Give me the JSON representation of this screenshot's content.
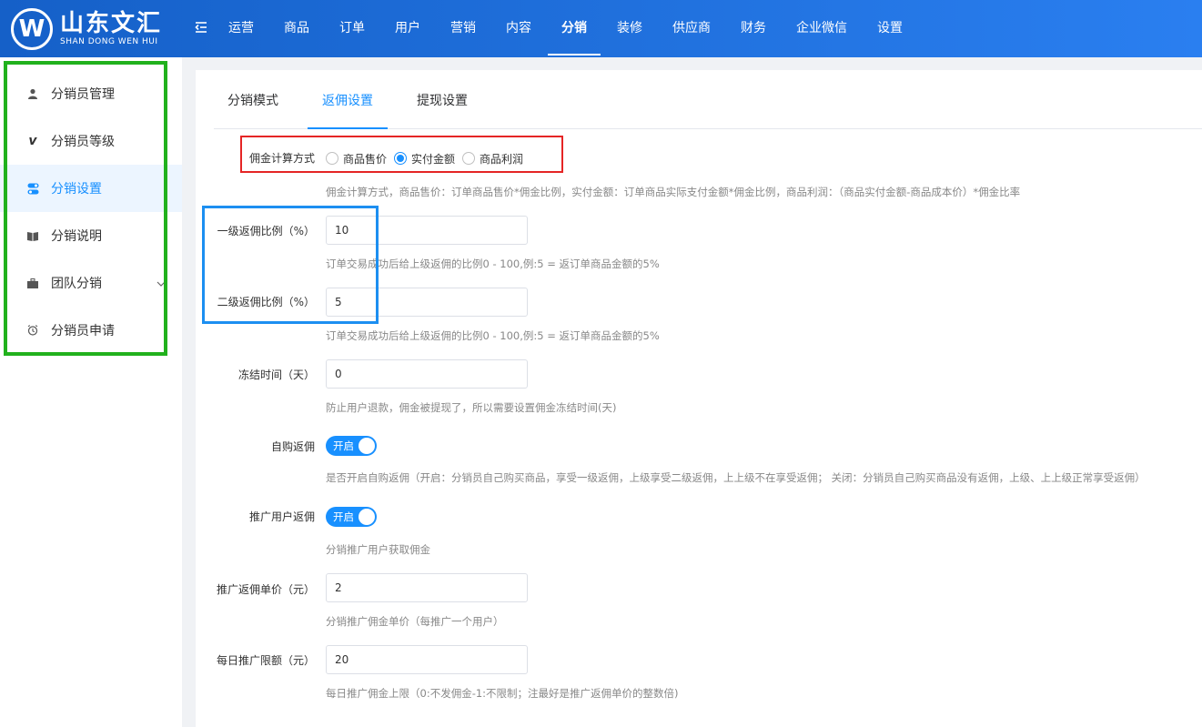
{
  "brand": {
    "name_cn": "山东文汇",
    "name_en": "SHAN DONG WEN HUI",
    "mark": "W"
  },
  "nav": {
    "items": [
      "运营",
      "商品",
      "订单",
      "用户",
      "营销",
      "内容",
      "分销",
      "装修",
      "供应商",
      "财务",
      "企业微信",
      "设置"
    ],
    "active": "分销"
  },
  "sidebar": {
    "items": [
      {
        "label": "分销员管理",
        "icon": "user-icon"
      },
      {
        "label": "分销员等级",
        "icon": "vimeo-icon"
      },
      {
        "label": "分销设置",
        "icon": "toggle-icon",
        "active": true
      },
      {
        "label": "分销说明",
        "icon": "book-icon"
      },
      {
        "label": "团队分销",
        "icon": "briefcase-icon",
        "has_submenu": true
      },
      {
        "label": "分销员申请",
        "icon": "alarm-clock-icon"
      }
    ]
  },
  "tabs": [
    "分销模式",
    "返佣设置",
    "提现设置"
  ],
  "active_tab": "返佣设置",
  "form": {
    "calc_method": {
      "label": "佣金计算方式",
      "options": [
        "商品售价",
        "实付金额",
        "商品利润"
      ],
      "selected": "实付金额",
      "hint": "佣金计算方式，商品售价：订单商品售价*佣金比例，实付金额：订单商品实际支付金额*佣金比例，商品利润：（商品实付金额-商品成本价）*佣金比率"
    },
    "level1": {
      "label": "一级返佣比例（%）",
      "value": "10",
      "hint": "订单交易成功后给上级返佣的比例0 - 100,例:5 = 返订单商品金额的5%"
    },
    "level2": {
      "label": "二级返佣比例（%）",
      "value": "5",
      "hint": "订单交易成功后给上级返佣的比例0 - 100,例:5 = 返订单商品金额的5%"
    },
    "freeze": {
      "label": "冻结时间（天）",
      "value": "0",
      "hint": "防止用户退款，佣金被提现了，所以需要设置佣金冻结时间(天)"
    },
    "self_buy": {
      "label": "自购返佣",
      "switch": "开启",
      "on": true,
      "hint": "是否开启自购返佣（开启：分销员自己购买商品，享受一级返佣，上级享受二级返佣，上上级不在享受返佣；  关闭：分销员自己购买商品没有返佣，上级、上上级正常享受返佣）"
    },
    "promote": {
      "label": "推广用户返佣",
      "switch": "开启",
      "on": true,
      "hint": "分销推广用户获取佣金"
    },
    "promote_price": {
      "label": "推广返佣单价（元）",
      "value": "2",
      "hint": "分销推广佣金单价（每推广一个用户）"
    },
    "daily_limit": {
      "label": "每日推广限额（元）",
      "value": "20",
      "hint": "每日推广佣金上限（0:不发佣金-1:不限制；注最好是推广返佣单价的整数倍)"
    }
  },
  "colors": {
    "accent": "#1890ff",
    "header": "#1d6fe0",
    "annot_green": "#21b11d",
    "annot_red": "#e52525",
    "annot_blue": "#1c8ff1"
  }
}
